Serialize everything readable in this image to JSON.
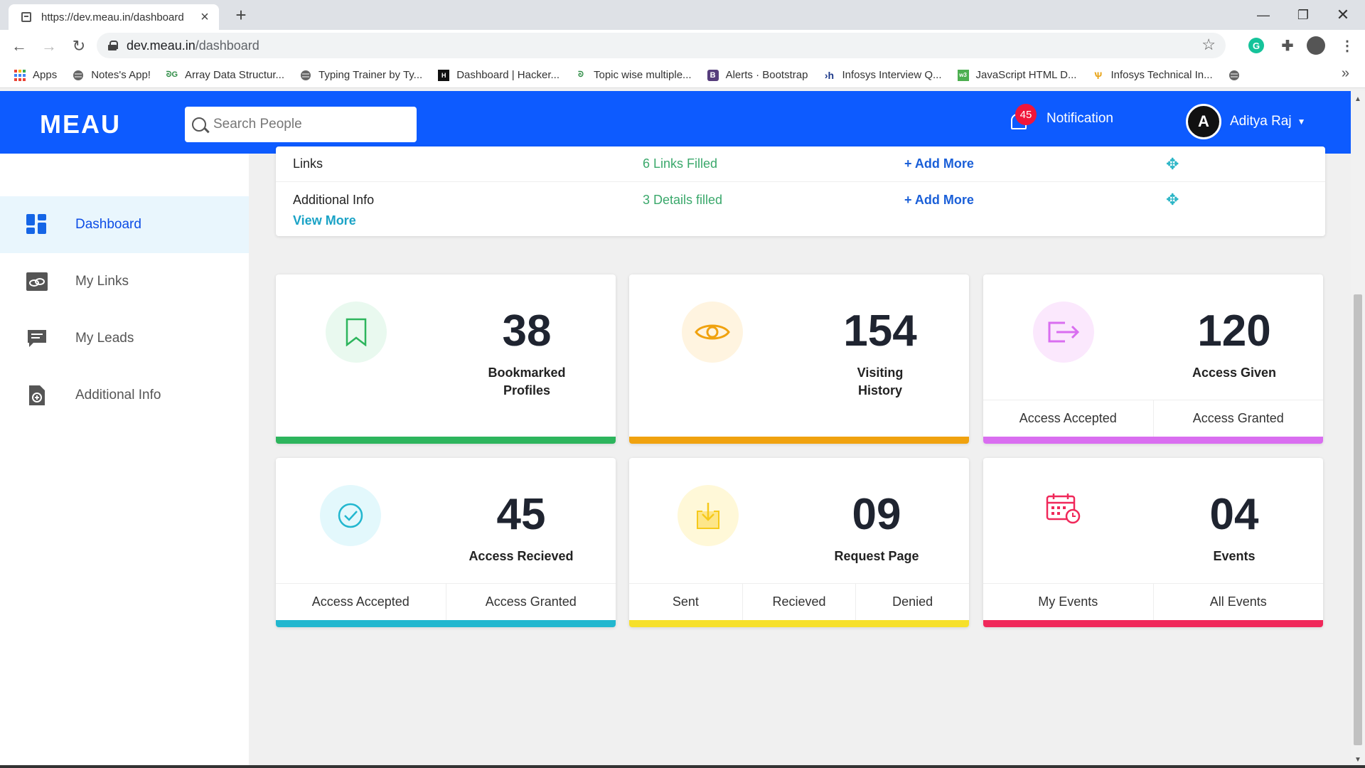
{
  "browser": {
    "tab_title": "https://dev.meau.in/dashboard",
    "url_host": "dev.meau.in",
    "url_path": "/dashboard",
    "bookmarks": [
      {
        "label": "Apps",
        "icon": "apps-grid-icon"
      },
      {
        "label": "Notes's App!",
        "icon": "globe-icon"
      },
      {
        "label": "Array Data Structur...",
        "icon": "gfg-icon"
      },
      {
        "label": "Typing Trainer by Ty...",
        "icon": "globe-icon"
      },
      {
        "label": "Dashboard | Hacker...",
        "icon": "hackerrank-icon"
      },
      {
        "label": "Topic wise multiple...",
        "icon": "gfg-icon"
      },
      {
        "label": "Alerts · Bootstrap",
        "icon": "bootstrap-icon"
      },
      {
        "label": "Infosys Interview Q...",
        "icon": "h-icon"
      },
      {
        "label": "JavaScript HTML D...",
        "icon": "w3-icon"
      },
      {
        "label": "Infosys Technical In...",
        "icon": "tree-icon"
      }
    ]
  },
  "topbar": {
    "logo": "MEAU",
    "search_placeholder": "Search People",
    "notification_count": "45",
    "notification_label": "Notification",
    "user_initial": "A",
    "user_name": "Aditya Raj"
  },
  "sidebar": {
    "items": [
      {
        "label": "Dashboard",
        "icon": "dashboard-grid-icon",
        "active": true
      },
      {
        "label": "My Links",
        "icon": "link-icon",
        "active": false
      },
      {
        "label": "My Leads",
        "icon": "chat-icon",
        "active": false
      },
      {
        "label": "Additional Info",
        "icon": "add-document-icon",
        "active": false
      }
    ]
  },
  "info": {
    "rows": [
      {
        "label": "Links",
        "value": "6 Links Filled",
        "action": "+ Add More"
      },
      {
        "label": "Additional Info",
        "value": "3 Details filled",
        "action": "+ Add More"
      }
    ],
    "view_more": "View More"
  },
  "cards": [
    {
      "number": "38",
      "label_line1": "Bookmarked",
      "label_line2": "Profiles",
      "icon": "bookmark-icon",
      "color": "#2db55d",
      "circle": "#e9f9ef"
    },
    {
      "number": "154",
      "label_line1": "Visiting",
      "label_line2": "History",
      "icon": "eye-icon",
      "color": "#f0a20f",
      "circle": "#fff4e0"
    },
    {
      "number": "120",
      "label_line1": "Access Given",
      "icon": "exit-arrow-icon",
      "color": "#d96ef0",
      "circle": "#fbe8fd",
      "footer": [
        "Access Accepted",
        "Access Granted"
      ]
    },
    {
      "number": "45",
      "label_line1": "Access Recieved",
      "icon": "check-circle-icon",
      "color": "#22b7cf",
      "circle": "#e3f8fc",
      "footer": [
        "Access Accepted",
        "Access Granted"
      ]
    },
    {
      "number": "09",
      "label_line1": "Request Page",
      "icon": "download-icon",
      "color": "#f6e02b",
      "circle": "#fff8d8",
      "footer": [
        "Sent",
        "Recieved",
        "Denied"
      ]
    },
    {
      "number": "04",
      "label_line1": "Events",
      "icon": "calendar-icon",
      "color": "#f0285a",
      "circle": "#ffffff",
      "footer": [
        "My Events",
        "All Events"
      ]
    }
  ]
}
